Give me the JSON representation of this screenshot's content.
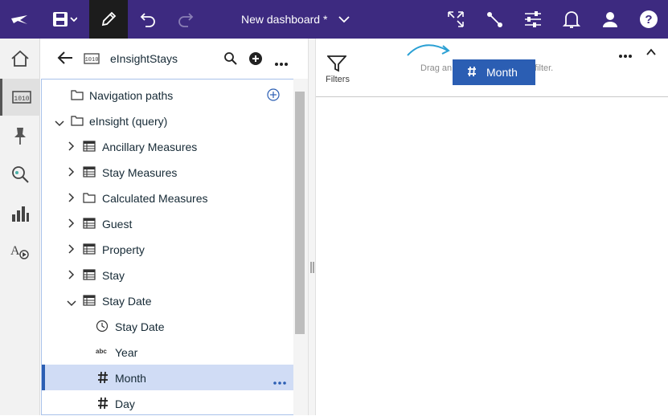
{
  "topbar": {
    "title": "New dashboard *",
    "bg_color": "#3d2a80",
    "icons": [
      "plane-logo-icon",
      "save-icon",
      "edit-pencil-icon",
      "undo-icon",
      "redo-icon",
      "expand-icon",
      "connection-icon",
      "sliders-icon",
      "bell-icon",
      "user-icon",
      "help-icon"
    ]
  },
  "panel": {
    "title": "eInsightStays"
  },
  "tree": {
    "items": [
      {
        "label": "Navigation paths",
        "icon": "folder-icon"
      },
      {
        "label": "eInsight (query)",
        "icon": "folder-icon"
      },
      {
        "label": "Ancillary Measures",
        "icon": "table-icon"
      },
      {
        "label": "Stay Measures",
        "icon": "table-icon"
      },
      {
        "label": "Calculated Measures",
        "icon": "folder-icon"
      },
      {
        "label": "Guest",
        "icon": "table-icon"
      },
      {
        "label": "Property",
        "icon": "table-icon"
      },
      {
        "label": "Stay",
        "icon": "table-icon"
      },
      {
        "label": "Stay Date",
        "icon": "table-icon"
      },
      {
        "label": "Stay Date",
        "icon": "clock-icon"
      },
      {
        "label": "Year",
        "icon": "abc-icon",
        "type_text": "abc"
      },
      {
        "label": "Month",
        "icon": "hash-icon",
        "selected": true
      },
      {
        "label": "Day",
        "icon": "hash-icon"
      }
    ]
  },
  "canvas": {
    "filters_label": "Filters",
    "drag_text": "Drag an",
    "drag_text_end": "filter.",
    "drag_chip_label": "Month",
    "accent_color": "#2b5eb3"
  }
}
